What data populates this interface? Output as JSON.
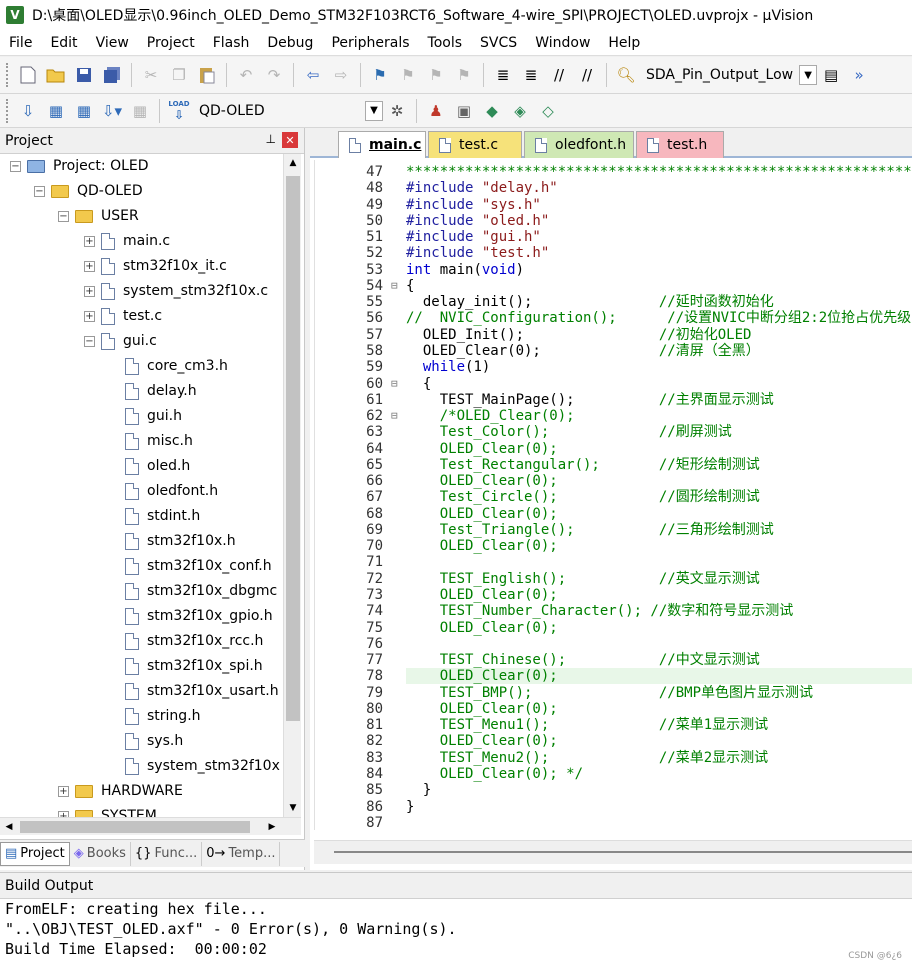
{
  "window": {
    "icon_text": "V",
    "title": "D:\\桌面\\OLED显示\\0.96inch_OLED_Demo_STM32F103RCT6_Software_4-wire_SPI\\PROJECT\\OLED.uvprojx - µVision"
  },
  "menu": [
    "File",
    "Edit",
    "View",
    "Project",
    "Flash",
    "Debug",
    "Peripherals",
    "Tools",
    "SVCS",
    "Window",
    "Help"
  ],
  "toolbar1": {
    "find_combo": "SDA_Pin_Output_Low"
  },
  "toolbar2": {
    "load_label": "LOAD",
    "target_combo": "QD-OLED"
  },
  "project_panel": {
    "title": "Project",
    "pin_icon": "⊥",
    "close_icon": "✕",
    "tree": [
      {
        "label": "Project: OLED",
        "level": 0,
        "kind": "project",
        "expander": "−"
      },
      {
        "label": "QD-OLED",
        "level": 1,
        "kind": "target",
        "expander": "−"
      },
      {
        "label": "USER",
        "level": 2,
        "kind": "folder",
        "expander": "−"
      },
      {
        "label": "main.c",
        "level": 3,
        "kind": "file",
        "expander": "+"
      },
      {
        "label": "stm32f10x_it.c",
        "level": 3,
        "kind": "file",
        "expander": "+"
      },
      {
        "label": "system_stm32f10x.c",
        "level": 3,
        "kind": "file",
        "expander": "+"
      },
      {
        "label": "test.c",
        "level": 3,
        "kind": "file",
        "expander": "+"
      },
      {
        "label": "gui.c",
        "level": 3,
        "kind": "file",
        "expander": "−"
      },
      {
        "label": "core_cm3.h",
        "level": 4,
        "kind": "file",
        "expander": ""
      },
      {
        "label": "delay.h",
        "level": 4,
        "kind": "file",
        "expander": ""
      },
      {
        "label": "gui.h",
        "level": 4,
        "kind": "file",
        "expander": ""
      },
      {
        "label": "misc.h",
        "level": 4,
        "kind": "file",
        "expander": ""
      },
      {
        "label": "oled.h",
        "level": 4,
        "kind": "file",
        "expander": ""
      },
      {
        "label": "oledfont.h",
        "level": 4,
        "kind": "file",
        "expander": ""
      },
      {
        "label": "stdint.h",
        "level": 4,
        "kind": "file",
        "expander": ""
      },
      {
        "label": "stm32f10x.h",
        "level": 4,
        "kind": "file",
        "expander": ""
      },
      {
        "label": "stm32f10x_conf.h",
        "level": 4,
        "kind": "file",
        "expander": ""
      },
      {
        "label": "stm32f10x_dbgmc",
        "level": 4,
        "kind": "file",
        "expander": ""
      },
      {
        "label": "stm32f10x_gpio.h",
        "level": 4,
        "kind": "file",
        "expander": ""
      },
      {
        "label": "stm32f10x_rcc.h",
        "level": 4,
        "kind": "file",
        "expander": ""
      },
      {
        "label": "stm32f10x_spi.h",
        "level": 4,
        "kind": "file",
        "expander": ""
      },
      {
        "label": "stm32f10x_usart.h",
        "level": 4,
        "kind": "file",
        "expander": ""
      },
      {
        "label": "string.h",
        "level": 4,
        "kind": "file",
        "expander": ""
      },
      {
        "label": "sys.h",
        "level": 4,
        "kind": "file",
        "expander": ""
      },
      {
        "label": "system_stm32f10x",
        "level": 4,
        "kind": "file",
        "expander": ""
      },
      {
        "label": "HARDWARE",
        "level": 2,
        "kind": "folder",
        "expander": "+"
      },
      {
        "label": "SYSTEM",
        "level": 2,
        "kind": "folder",
        "expander": "+"
      }
    ],
    "bottom_tabs": [
      {
        "label": "Project",
        "icon": "▤",
        "active": true
      },
      {
        "label": "Books",
        "icon": "◈",
        "active": false
      },
      {
        "label": "Func...",
        "icon": "{}",
        "active": false
      },
      {
        "label": "Temp...",
        "icon": "0→",
        "active": false
      }
    ]
  },
  "editor": {
    "tabs": [
      {
        "label": "main.c",
        "active": true,
        "color": "#f6e27a"
      },
      {
        "label": "test.c",
        "active": false,
        "color": "#f6e27a"
      },
      {
        "label": "oledfont.h",
        "active": false,
        "color": "#cfe8b4"
      },
      {
        "label": "test.h",
        "active": false,
        "color": "#f7b7be"
      }
    ],
    "lines": [
      {
        "num": "47",
        "gutter": "",
        "parts": [
          {
            "t": "******************************************************************",
            "c": "cm"
          }
        ]
      },
      {
        "num": "48",
        "gutter": "",
        "parts": [
          {
            "t": "#include ",
            "c": "pp"
          },
          {
            "t": "\"delay.h\"",
            "c": "str"
          }
        ]
      },
      {
        "num": "49",
        "gutter": "",
        "parts": [
          {
            "t": "#include ",
            "c": "pp"
          },
          {
            "t": "\"sys.h\"",
            "c": "str"
          }
        ]
      },
      {
        "num": "50",
        "gutter": "",
        "parts": [
          {
            "t": "#include ",
            "c": "pp"
          },
          {
            "t": "\"oled.h\"",
            "c": "str"
          }
        ]
      },
      {
        "num": "51",
        "gutter": "",
        "parts": [
          {
            "t": "#include ",
            "c": "pp"
          },
          {
            "t": "\"gui.h\"",
            "c": "str"
          }
        ]
      },
      {
        "num": "52",
        "gutter": "",
        "parts": [
          {
            "t": "#include ",
            "c": "pp"
          },
          {
            "t": "\"test.h\"",
            "c": "str"
          }
        ]
      },
      {
        "num": "53",
        "gutter": "",
        "parts": [
          {
            "t": "int",
            "c": "kw"
          },
          {
            "t": " main(",
            "c": ""
          },
          {
            "t": "void",
            "c": "kw"
          },
          {
            "t": ")",
            "c": ""
          }
        ]
      },
      {
        "num": "54",
        "gutter": "⊟",
        "parts": [
          {
            "t": "{",
            "c": ""
          }
        ]
      },
      {
        "num": "55",
        "gutter": "",
        "parts": [
          {
            "t": "  delay_init();               ",
            "c": ""
          },
          {
            "t": "//延时函数初始化",
            "c": "cm"
          }
        ]
      },
      {
        "num": "56",
        "gutter": "",
        "parts": [
          {
            "t": "//  NVIC_Configuration();      //设置NVIC中断分组2:2位抢占优先级",
            "c": "cm"
          }
        ]
      },
      {
        "num": "57",
        "gutter": "",
        "parts": [
          {
            "t": "  OLED_Init();                ",
            "c": ""
          },
          {
            "t": "//初始化OLED",
            "c": "cm"
          }
        ]
      },
      {
        "num": "58",
        "gutter": "",
        "parts": [
          {
            "t": "  OLED_Clear(0);              ",
            "c": ""
          },
          {
            "t": "//清屏（全黑）",
            "c": "cm"
          }
        ]
      },
      {
        "num": "59",
        "gutter": "",
        "parts": [
          {
            "t": "  ",
            "c": ""
          },
          {
            "t": "while",
            "c": "kw"
          },
          {
            "t": "(1)",
            "c": ""
          }
        ]
      },
      {
        "num": "60",
        "gutter": "⊟",
        "parts": [
          {
            "t": "  {",
            "c": ""
          }
        ]
      },
      {
        "num": "61",
        "gutter": "",
        "parts": [
          {
            "t": "    TEST_MainPage();          ",
            "c": ""
          },
          {
            "t": "//主界面显示测试",
            "c": "cm"
          }
        ]
      },
      {
        "num": "62",
        "gutter": "⊟",
        "parts": [
          {
            "t": "    /*OLED_Clear(0);",
            "c": "cm"
          }
        ]
      },
      {
        "num": "63",
        "gutter": "",
        "parts": [
          {
            "t": "    Test_Color();             //刷屏测试",
            "c": "cm"
          }
        ]
      },
      {
        "num": "64",
        "gutter": "",
        "parts": [
          {
            "t": "    OLED_Clear(0);",
            "c": "cm"
          }
        ]
      },
      {
        "num": "65",
        "gutter": "",
        "parts": [
          {
            "t": "    Test_Rectangular();       //矩形绘制测试",
            "c": "cm"
          }
        ]
      },
      {
        "num": "66",
        "gutter": "",
        "parts": [
          {
            "t": "    OLED_Clear(0);",
            "c": "cm"
          }
        ]
      },
      {
        "num": "67",
        "gutter": "",
        "parts": [
          {
            "t": "    Test_Circle();            //圆形绘制测试",
            "c": "cm"
          }
        ]
      },
      {
        "num": "68",
        "gutter": "",
        "parts": [
          {
            "t": "    OLED_Clear(0);",
            "c": "cm"
          }
        ]
      },
      {
        "num": "69",
        "gutter": "",
        "parts": [
          {
            "t": "    Test_Triangle();          //三角形绘制测试",
            "c": "cm"
          }
        ]
      },
      {
        "num": "70",
        "gutter": "",
        "parts": [
          {
            "t": "    OLED_Clear(0);",
            "c": "cm"
          }
        ]
      },
      {
        "num": "71",
        "gutter": "",
        "parts": [
          {
            "t": "",
            "c": ""
          }
        ]
      },
      {
        "num": "72",
        "gutter": "",
        "parts": [
          {
            "t": "    TEST_English();           //英文显示测试",
            "c": "cm"
          }
        ]
      },
      {
        "num": "73",
        "gutter": "",
        "parts": [
          {
            "t": "    OLED_Clear(0);",
            "c": "cm"
          }
        ]
      },
      {
        "num": "74",
        "gutter": "",
        "parts": [
          {
            "t": "    TEST_Number_Character(); //数字和符号显示测试",
            "c": "cm"
          }
        ]
      },
      {
        "num": "75",
        "gutter": "",
        "parts": [
          {
            "t": "    OLED_Clear(0);",
            "c": "cm"
          }
        ]
      },
      {
        "num": "76",
        "gutter": "",
        "parts": [
          {
            "t": "",
            "c": ""
          }
        ]
      },
      {
        "num": "77",
        "gutter": "",
        "parts": [
          {
            "t": "    TEST_Chinese();           //中文显示测试",
            "c": "cm"
          }
        ]
      },
      {
        "num": "78",
        "gutter": "",
        "hl": true,
        "parts": [
          {
            "t": "    OLED_Clear(0);",
            "c": "cm"
          }
        ]
      },
      {
        "num": "79",
        "gutter": "",
        "parts": [
          {
            "t": "    TEST_BMP();               //BMP单色图片显示测试",
            "c": "cm"
          }
        ]
      },
      {
        "num": "80",
        "gutter": "",
        "parts": [
          {
            "t": "    OLED_Clear(0);",
            "c": "cm"
          }
        ]
      },
      {
        "num": "81",
        "gutter": "",
        "parts": [
          {
            "t": "    TEST_Menu1();             //菜单1显示测试",
            "c": "cm"
          }
        ]
      },
      {
        "num": "82",
        "gutter": "",
        "parts": [
          {
            "t": "    OLED_Clear(0);",
            "c": "cm"
          }
        ]
      },
      {
        "num": "83",
        "gutter": "",
        "parts": [
          {
            "t": "    TEST_Menu2();             //菜单2显示测试",
            "c": "cm"
          }
        ]
      },
      {
        "num": "84",
        "gutter": "",
        "parts": [
          {
            "t": "    OLED_Clear(0); */",
            "c": "cm"
          }
        ]
      },
      {
        "num": "85",
        "gutter": "",
        "parts": [
          {
            "t": "  }",
            "c": ""
          }
        ]
      },
      {
        "num": "86",
        "gutter": "",
        "parts": [
          {
            "t": "}",
            "c": ""
          }
        ]
      },
      {
        "num": "87",
        "gutter": "",
        "parts": [
          {
            "t": "",
            "c": ""
          }
        ]
      }
    ]
  },
  "build_output": {
    "title": "Build Output",
    "lines": [
      "FromELF: creating hex file...",
      "\"..\\OBJ\\TEST_OLED.axf\" - 0 Error(s), 0 Warning(s).",
      "Build Time Elapsed:  00:00:02"
    ]
  },
  "watermark": "CSDN @6¿6"
}
